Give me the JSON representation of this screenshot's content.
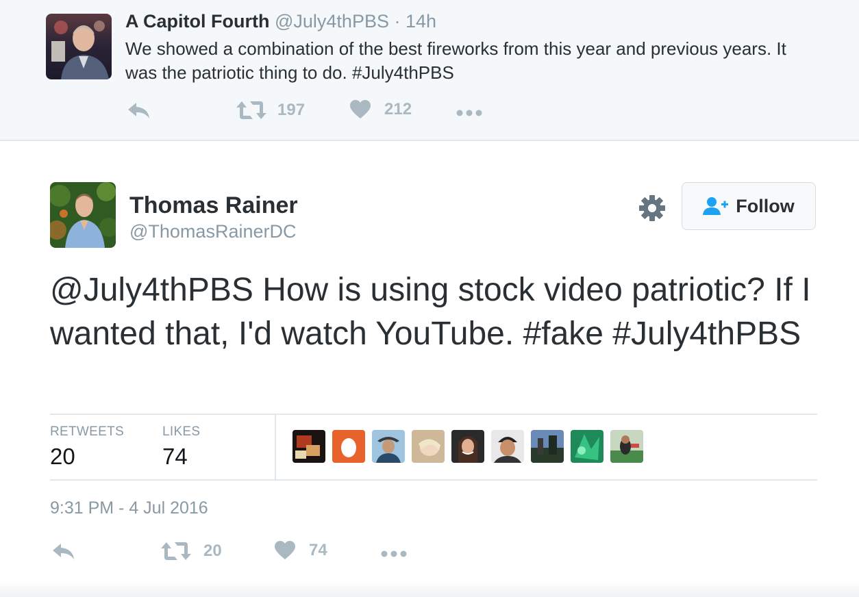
{
  "parent_tweet": {
    "name": "A Capitol Fourth",
    "handle": "@July4thPBS",
    "separator": "·",
    "time": "14h",
    "text": "We showed a combination of the best fireworks from this year and previous years. It was the patriotic thing to do. #July4thPBS",
    "retweets": "197",
    "likes": "212",
    "icons": [
      "reply-icon",
      "retweet-icon",
      "heart-icon",
      "more-icon"
    ]
  },
  "main_tweet": {
    "name": "Thomas Rainer",
    "handle": "@ThomasRainerDC",
    "follow_label": "Follow",
    "text": "@July4thPBS How is using stock video patriotic? If I wanted that, I'd watch YouTube. #fake #July4thPBS",
    "stats": {
      "retweets_label": "RETWEETS",
      "retweets_value": "20",
      "likes_label": "LIKES",
      "likes_value": "74"
    },
    "timestamp": "9:31 PM - 4 Jul 2016",
    "action_retweets": "20",
    "action_likes": "74",
    "icons": [
      "gear-icon",
      "follow-user-icon",
      "reply-icon",
      "retweet-icon",
      "heart-icon",
      "more-icon"
    ]
  },
  "colors": {
    "text": "#292f33",
    "muted": "#8899a6",
    "action_icon": "#aab8c2",
    "follow_icon": "#1da1f2",
    "parent_bg": "#f5f8fa",
    "border": "#e1e8ed"
  }
}
